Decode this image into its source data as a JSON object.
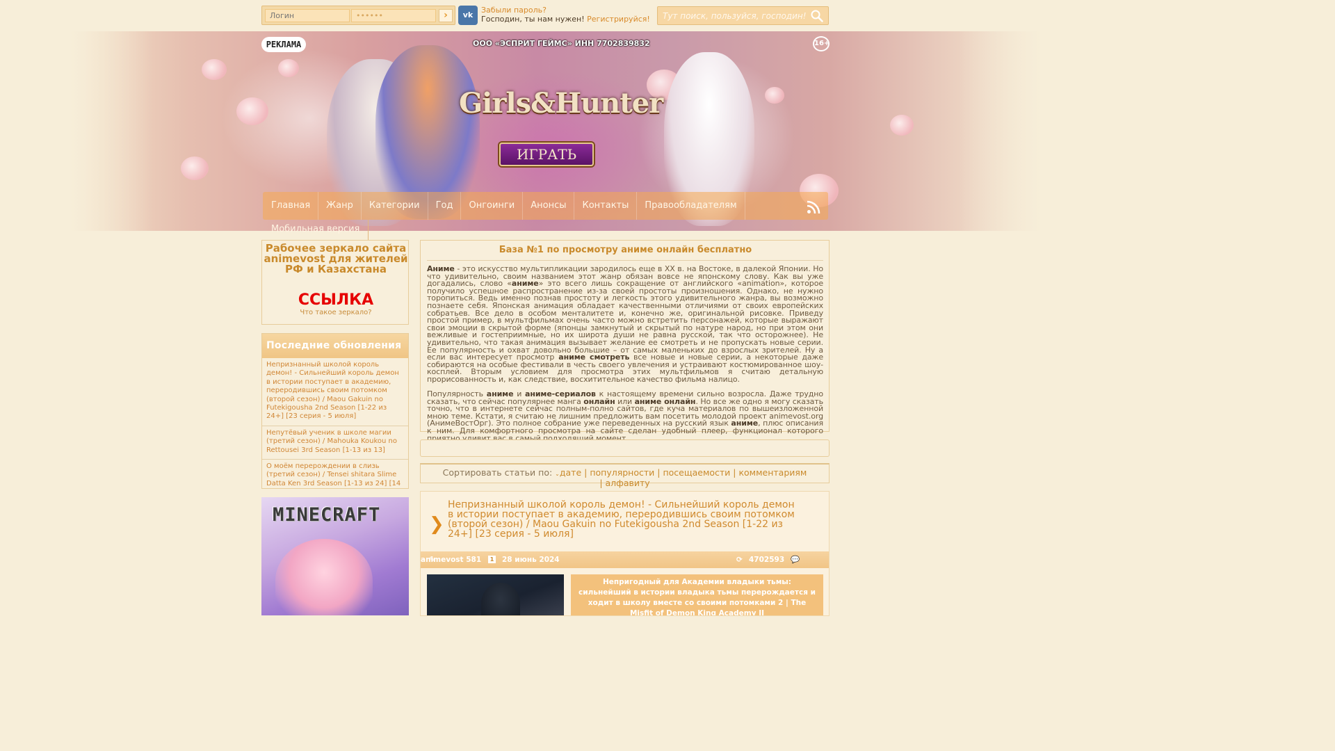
{
  "top": {
    "login_placeholder": "Логин",
    "password_value": "••••••",
    "login_submit": "›",
    "vk_label": "vk",
    "forgot_password": "Забыли пароль?",
    "register_prompt": "Господин, ты нам нужен!",
    "register_link": "Регистрируйся!",
    "search_placeholder": "Тут поиск, пользуйся, господин!"
  },
  "banner": {
    "ad_label": "РЕКЛАМА",
    "age_rating": "16+",
    "company": "ООО «ЭСПРИТ ГЕЙМС» ИНН 7702839832",
    "game_logo": "Girls&Hunter",
    "play_button": "ИГРАТЬ"
  },
  "nav": {
    "items": [
      "Главная",
      "Жанр",
      "Категории",
      "Год",
      "Онгоинги",
      "Анонсы",
      "Контакты",
      "Правообладателям"
    ],
    "mobile": "Мобильная версия"
  },
  "mirror": {
    "title": "Рабочее зеркало сайта animevost для жителей РФ и Казахстана",
    "link": "ССЫЛКА",
    "what": "Что такое зеркало?"
  },
  "updates": {
    "header": "Последние обновления",
    "items": [
      "Непризнанный школой король демон! - Сильнейший король демон в истории поступает в академию, переродившись своим потомком (второй сезон) / Maou Gakuin no Futekigousha 2nd Season [1-22 из 24+] [23 серия - 5 июля]",
      "Непутёвый ученик в школе магии (третий сезон) / Mahouka Koukou no Rettousei 3rd Season [1-13 из 13]",
      "О моём перерождении в слизь (третий сезон) / Tensei shitara Slime Datta Ken 3rd Season [1-13 из 24] [14"
    ]
  },
  "ad_minecraft": {
    "logo": "MINECRAFT"
  },
  "intro": {
    "title": "База №1 по просмотру аниме онлайн бесплатно",
    "p1_parts": [
      "Аниме",
      " - это искусство мультипликации зародилось еще в XX в. на Востоке, в далекой Японии. Но что удивительно, своим названием этот жанр обязан вовсе не японскому слову. Как вы уже догадались, слово «",
      "аниме",
      "» это всего лишь сокращение от английского «animation», которое получило успешное распространение из-за своей простоты произношения. Однако, не нужно торопиться. Ведь именно познав простоту и легкость этого удивительного жанра, вы возможно познаете себя. Японская анимация обладает качественными отличиями от своих европейских собратьев. Все дело в особом менталитете и, конечно же, оригинальной рисовке. Приведу простой пример, в мультфильмах очень часто можно встретить персонажей, которые выражают свои эмоции в скрытой форме (японцы замкнутый и скрытый по натуре народ, но при этом они вежливые и гостеприимные, но их широта души не равна русской, так что осторожнее). Не удивительно, что такая анимация вызывает желание ее смотреть и не пропускать новые серии. Ее популярность и охват довольно большие – от самых маленьких до взрослых зрителей. Ну а если вас интересует просмотр",
      " аниме смотреть",
      " все новые и новые серии, а некоторые даже собираются на особые фестивали в честь своего увлечения и устраивают костюмированное шоу-косплей. Вторым условием для просмотра этих мультфильмов я считаю детальную прорисованность и, как следствие, восхитительное качество фильма налицо."
    ],
    "p2_parts": [
      "Популярность ",
      "аниме",
      " и ",
      "аниме-сериалов",
      " к настоящему времени сильно возросла. Даже трудно сказать, что сейчас популярнее манга ",
      "онлайн",
      " или ",
      "аниме онлайн",
      ". Но все же одно я могу сказать точно, что в интернете сейчас полным-полно сайтов, где куча материалов по вышеизложенной мною теме. Кстати, я считаю не лишним предложить вам посетить молодой проект animevost.org (АнимеВостОрг). Это полное собрание уже переведенных на русский язык ",
      "аниме",
      ", плюс описания к ним. Для комфортного просмотра на сайте сделан удобный плеер, функционал которого приятно удивит вас в самый подходящий момент."
    ]
  },
  "sort": {
    "label": "Сортировать статьи по:",
    "options": [
      "дате",
      "популярности",
      "посещаемости",
      "комментариям",
      "алфавиту"
    ]
  },
  "post": {
    "title": "Непризнанный школой король демон! - Сильнейший король демон в истории поступает в академию, переродившись своим потомком (второй сезон) / Maou Gakuin no Futekigousha 2nd Season [1-22 из 24+] [23 серия - 5 июля]",
    "author": "animevost",
    "badge": "1",
    "date": "28 июнь 2024",
    "views": "4702593",
    "comments": "581",
    "description": "Непригодный для Академии владыки тьмы: сильнейший в истории владыка тьмы перерождается и ходит в школу вместе со своими потомками 2 | The Misfit of Demon King Academy II"
  },
  "colors": {
    "accent": "#d08a2e",
    "link_red": "#e60000",
    "bg": "#f7eed9"
  }
}
